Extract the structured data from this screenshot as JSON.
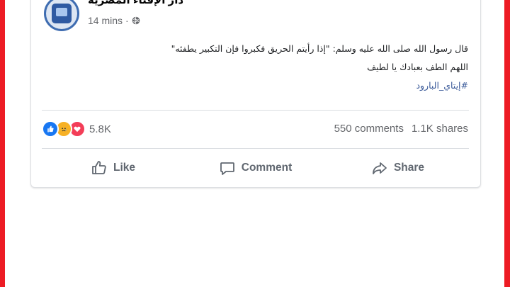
{
  "post": {
    "page_name": "دار الإفتاء المصرية",
    "time": "14 mins",
    "separator": "·",
    "visibility_icon": "globe-icon",
    "text_line1": "قال رسول الله صلى الله عليه وسلم: \"إذا رأيتم الحريق فكبروا فإن التكبير يطفئه\"",
    "text_line2": "اللهم الطف بعبادك يا لطيف",
    "hashtag": "#إيتاي_البارود"
  },
  "engagement": {
    "reaction_icons": [
      "like-reaction-icon",
      "sad-reaction-icon",
      "love-reaction-icon"
    ],
    "reaction_count": "5.8K",
    "comments": "550 comments",
    "shares": "1.1K shares"
  },
  "actions": {
    "like_label": "Like",
    "comment_label": "Comment",
    "share_label": "Share"
  },
  "colors": {
    "frame": "#ed1c24",
    "like_blue": "#1877f2",
    "love_red": "#f33e58",
    "sad_yellow": "#f7b125",
    "hashtag": "#385898"
  }
}
